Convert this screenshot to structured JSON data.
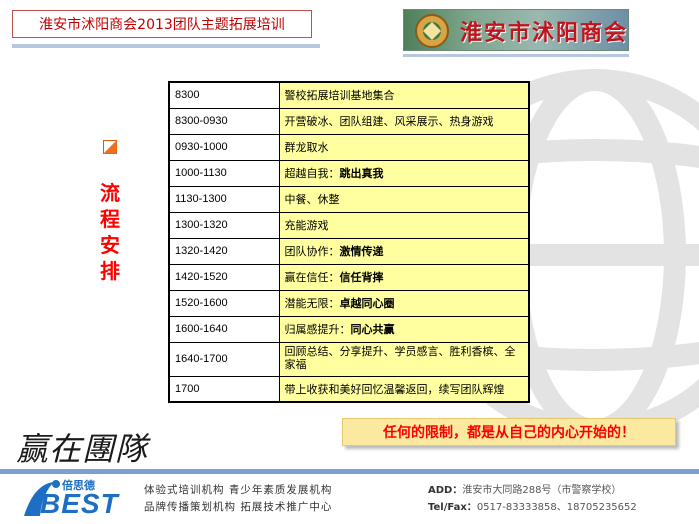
{
  "header": {
    "title": "淮安市沭阳商会2013团队主题拓展培训",
    "logo_text": "淮安市沭阳商会"
  },
  "sidebar": {
    "vertical_title": [
      "流",
      "程",
      "安",
      "排"
    ]
  },
  "schedule": [
    {
      "time": "8300",
      "activity": "警校拓展培训基地集合",
      "bold": ""
    },
    {
      "time": "8300-0930",
      "activity": "开营破冰、团队组建、风采展示、热身游戏",
      "bold": ""
    },
    {
      "time": "0930-1000",
      "activity": "群龙取水",
      "bold": ""
    },
    {
      "time": "1000-1130",
      "activity": "超越自我：",
      "bold": "跳出真我"
    },
    {
      "time": "1130-1300",
      "activity": "中餐、休整",
      "bold": ""
    },
    {
      "time": "1300-1320",
      "activity": "充能游戏",
      "bold": ""
    },
    {
      "time": "1320-1420",
      "activity": "团队协作：",
      "bold": "激情传递"
    },
    {
      "time": "1420-1520",
      "activity": "赢在信任：",
      "bold": "信任背摔"
    },
    {
      "time": "1520-1600",
      "activity": "潜能无限：",
      "bold": "卓越同心圈"
    },
    {
      "time": "1600-1640",
      "activity": "归属感提升：",
      "bold": "同心共赢"
    },
    {
      "time": "1640-1700",
      "activity": "回顾总结、分享提升、学员感言、胜利香槟、全家福",
      "bold": ""
    },
    {
      "time": "1700",
      "activity": "带上收获和美好回忆温馨返回，续写团队辉煌",
      "bold": ""
    }
  ],
  "motto": "任何的限制，都是从自己的内心开始的！",
  "calligraphy": "赢在團隊",
  "footer": {
    "brand_cn": "倍思德",
    "brand_en": "BEST",
    "services_line1": "体验式培训机构  青少年素质发展机构",
    "services_line2": "品牌传播策划机构  拓展技术推广中心",
    "addr_label": "ADD：",
    "addr_value": "淮安市大同路288号（市警察学校）",
    "tel_label": "Tel/Fax：",
    "tel_value": "0517-83333858、18705235652"
  },
  "colors": {
    "title_red": "#c00000",
    "vertical_red": "#ff0000",
    "cell_yellow": "#ffffa0",
    "motto_bg": "#fbe9a0",
    "brand_blue": "#1c6fc4"
  }
}
